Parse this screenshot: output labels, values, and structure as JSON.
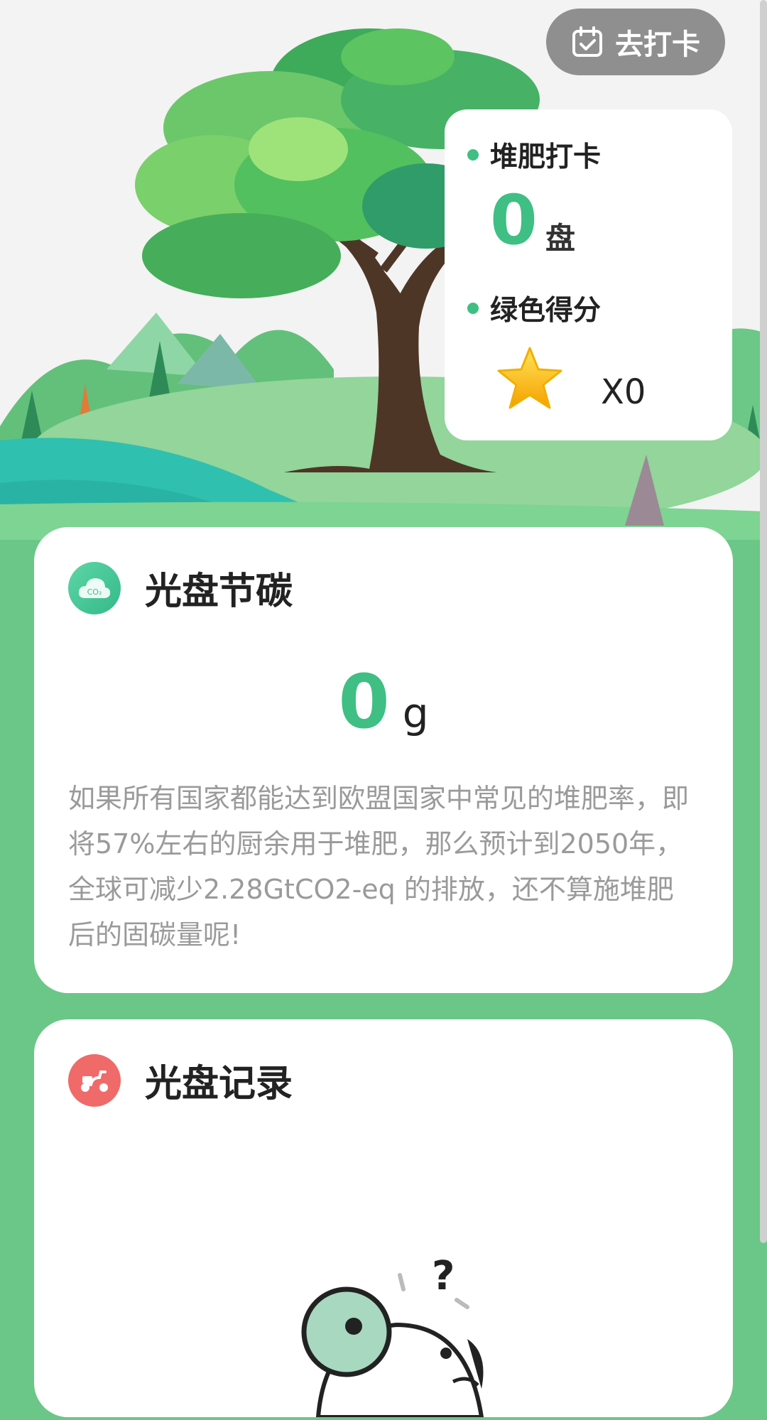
{
  "header": {
    "checkin_label": "去打卡",
    "checkin_icon": "calendar-check-icon"
  },
  "stats": {
    "compost_title": "堆肥打卡",
    "compost_count": "0",
    "compost_unit": "盘",
    "score_title": "绿色得分",
    "score_value": "X0",
    "score_icon": "star-icon"
  },
  "carbon_card": {
    "title": "光盘节碳",
    "icon": "co2-cloud-icon",
    "icon_text": "CO₂",
    "value": "0",
    "unit": "g",
    "description": "如果所有国家都能达到欧盟国家中常见的堆肥率，即将57%左右的厨余用于堆肥，那么预计到2050年，全球可减少2.28GtCO2-eq 的排放，还不算施堆肥后的固碳量呢!"
  },
  "record_card": {
    "title": "光盘记录",
    "icon": "scooter-icon"
  },
  "colors": {
    "accent": "#3fbf83",
    "background": "#6bc787",
    "record_icon": "#f06a6a"
  }
}
